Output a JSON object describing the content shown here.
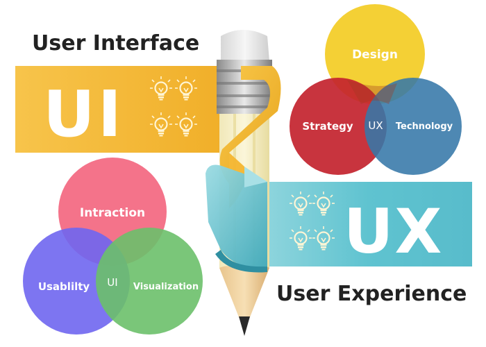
{
  "ui": {
    "heading": "User Interface",
    "banner_text": "UI",
    "center_label": "UI",
    "circles": {
      "top": "Intraction",
      "left": "Usablilty",
      "right": "Visualization"
    },
    "banner_color": "#f3b83a",
    "circle_colors": {
      "top": "#f36b84",
      "left": "#6f66f0",
      "right": "#6cc06a"
    }
  },
  "ux": {
    "heading": "User Experience",
    "banner_text": "UX",
    "center_label": "UX",
    "circles": {
      "top": "Design",
      "left": "Strategy",
      "right": "Technology"
    },
    "banner_color": "#55bfcf",
    "circle_colors": {
      "top": "#f3cd2a",
      "left": "#c3232e",
      "right": "#3577a8"
    }
  },
  "icons": [
    "lightbulb-icon",
    "pencil-icon"
  ]
}
